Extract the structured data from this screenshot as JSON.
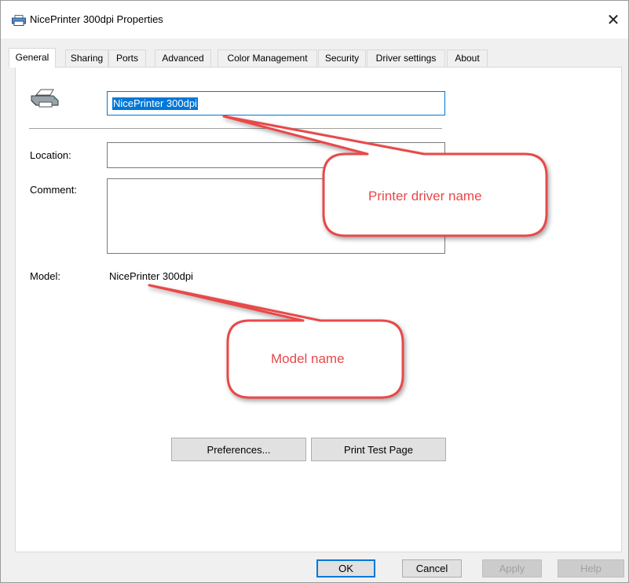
{
  "window": {
    "title": "NicePrinter 300dpi Properties",
    "close_symbol": "✕"
  },
  "tabs": [
    {
      "label": "General",
      "active": true
    },
    {
      "label": "Sharing"
    },
    {
      "label": "Ports"
    },
    {
      "label": "Advanced"
    },
    {
      "label": "Color Management"
    },
    {
      "label": "Security"
    },
    {
      "label": "Driver settings"
    },
    {
      "label": "About"
    }
  ],
  "general": {
    "printer_name": "NicePrinter 300dpi",
    "location_label": "Location:",
    "location_value": "",
    "comment_label": "Comment:",
    "comment_value": "",
    "model_label": "Model:",
    "model_value": "NicePrinter 300dpi",
    "preferences_button": "Preferences...",
    "print_test_button": "Print Test Page"
  },
  "footer": {
    "ok": "OK",
    "cancel": "Cancel",
    "apply": "Apply",
    "help": "Help"
  },
  "annotations": {
    "driver_callout": "Printer driver name",
    "model_callout": "Model name",
    "callout_color": "#e8484a"
  },
  "colors": {
    "accent": "#0078d7",
    "tab_border": "#d9d9d9",
    "panel_bg": "#ffffff",
    "window_bg": "#f0f0f0"
  }
}
